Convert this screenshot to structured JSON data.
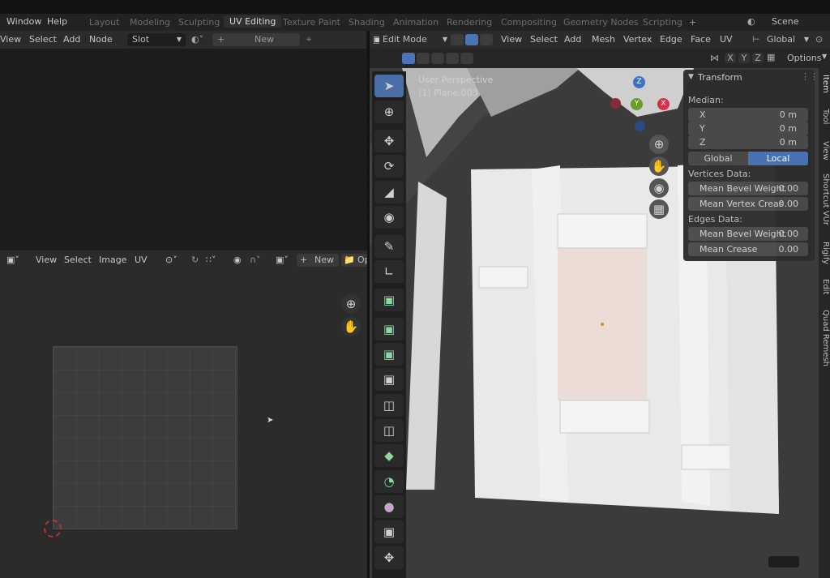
{
  "top_menu": {
    "window": "Window",
    "help": "Help"
  },
  "workspace_tabs": [
    "Layout",
    "Modeling",
    "Sculpting",
    "UV Editing",
    "Texture Paint",
    "Shading",
    "Animation",
    "Rendering",
    "Compositing",
    "Geometry Nodes",
    "Scripting"
  ],
  "active_workspace": "UV Editing",
  "add_tab": "+",
  "scene": {
    "label": "Scene"
  },
  "shader_header": {
    "view": "View",
    "select": "Select",
    "add": "Add",
    "node": "Node",
    "slot": "Slot",
    "new": "New"
  },
  "uv_header": {
    "view": "View",
    "select": "Select",
    "image": "Image",
    "uv": "UV",
    "new": "New",
    "open": "Op"
  },
  "viewport_header": {
    "mode": "Edit Mode",
    "view": "View",
    "select": "Select",
    "add": "Add",
    "mesh": "Mesh",
    "vertex": "Vertex",
    "edge": "Edge",
    "face": "Face",
    "uv": "UV",
    "orientation": "Global",
    "options": "Options"
  },
  "mirror_axes": [
    "X",
    "Y",
    "Z"
  ],
  "viewport_info": {
    "perspective": "User Perspective",
    "object": "(1) Plane.003"
  },
  "gizmo_axes": {
    "z": "Z",
    "y": "Y",
    "x": "X"
  },
  "transform_panel": {
    "title": "Transform",
    "median_label": "Median:",
    "median": [
      {
        "axis": "X",
        "value": "0 m"
      },
      {
        "axis": "Y",
        "value": "0 m"
      },
      {
        "axis": "Z",
        "value": "0 m"
      }
    ],
    "global": "Global",
    "local": "Local",
    "vertices_label": "Vertices Data:",
    "vertices": [
      {
        "label": "Mean Bevel Weight",
        "value": "0.00"
      },
      {
        "label": "Mean Vertex Creas",
        "value": "0.00"
      }
    ],
    "edges_label": "Edges Data:",
    "edges": [
      {
        "label": "Mean Bevel Weight",
        "value": "0.00"
      },
      {
        "label": "Mean Crease",
        "value": "0.00"
      }
    ]
  },
  "sidebar_tabs": [
    "Item",
    "Tool",
    "View",
    "Shortcut VUr",
    "Rigify",
    "Edit",
    "Quad Remesh"
  ],
  "colors": {
    "accent": "#4a74b6",
    "x_axis": "#d5304a",
    "y_axis": "#6a9c2a",
    "z_axis": "#3b73c8"
  }
}
